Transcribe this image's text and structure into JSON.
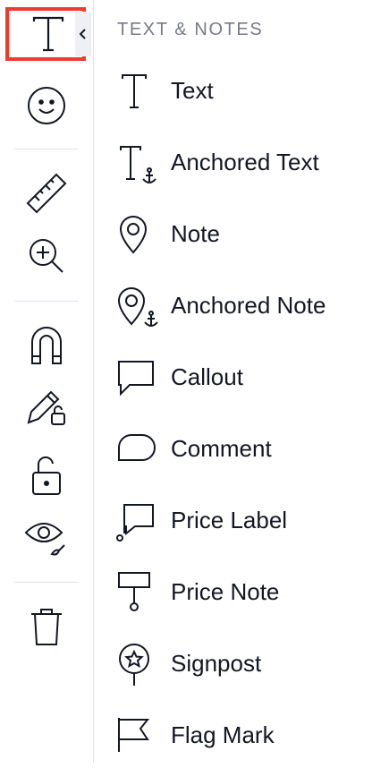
{
  "panel": {
    "title": "TEXT & NOTES",
    "items": [
      {
        "label": "Text",
        "icon": "text-icon"
      },
      {
        "label": "Anchored Text",
        "icon": "anchored-text-icon"
      },
      {
        "label": "Note",
        "icon": "note-pin-icon"
      },
      {
        "label": "Anchored Note",
        "icon": "anchored-note-icon"
      },
      {
        "label": "Callout",
        "icon": "callout-icon"
      },
      {
        "label": "Comment",
        "icon": "comment-icon"
      },
      {
        "label": "Price Label",
        "icon": "price-label-icon"
      },
      {
        "label": "Price Note",
        "icon": "price-note-icon"
      },
      {
        "label": "Signpost",
        "icon": "signpost-icon"
      },
      {
        "label": "Flag Mark",
        "icon": "flag-mark-icon"
      }
    ]
  },
  "toolbar": {
    "tools": [
      "text-tool-icon",
      "emoji-icon",
      "ruler-icon",
      "zoom-in-icon",
      "magnet-icon",
      "pencil-lock-icon",
      "lock-icon",
      "eye-icon",
      "trash-icon"
    ]
  },
  "colors": {
    "highlight": "#f23b2e",
    "text": "#131722",
    "muted": "#787b86",
    "divider": "#e0e3eb"
  }
}
